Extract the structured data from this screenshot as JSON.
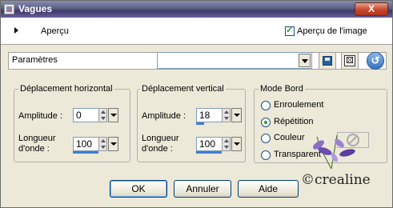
{
  "window": {
    "title": "Vagues",
    "close_label": "X"
  },
  "preview": {
    "label": "Aperçu",
    "image_preview_label": "Aperçu de l'image",
    "image_preview_checked": true
  },
  "params": {
    "label": "Paramètres",
    "preset_value": ""
  },
  "horizontal": {
    "title": "Déplacement horizontal",
    "amplitude_label": "Amplitude :",
    "amplitude_value": "0",
    "wavelength_label_1": "Longueur",
    "wavelength_label_2": "d'onde :",
    "wavelength_value": "100"
  },
  "vertical": {
    "title": "Déplacement vertical",
    "amplitude_label": "Amplitude :",
    "amplitude_value": "18",
    "wavelength_label_1": "Longueur",
    "wavelength_label_2": "d'onde :",
    "wavelength_value": "100"
  },
  "edge_mode": {
    "title": "Mode Bord",
    "options": [
      "Enroulement",
      "Répétition",
      "Couleur",
      "Transparent"
    ],
    "selected": "Répétition"
  },
  "buttons": {
    "ok": "OK",
    "cancel": "Annuler",
    "help": "Aide"
  },
  "watermark": "©crealine",
  "colors": {
    "accent": "#3f7fd2",
    "title_bar": "#4a4878",
    "selected_radio": "#21a121"
  }
}
